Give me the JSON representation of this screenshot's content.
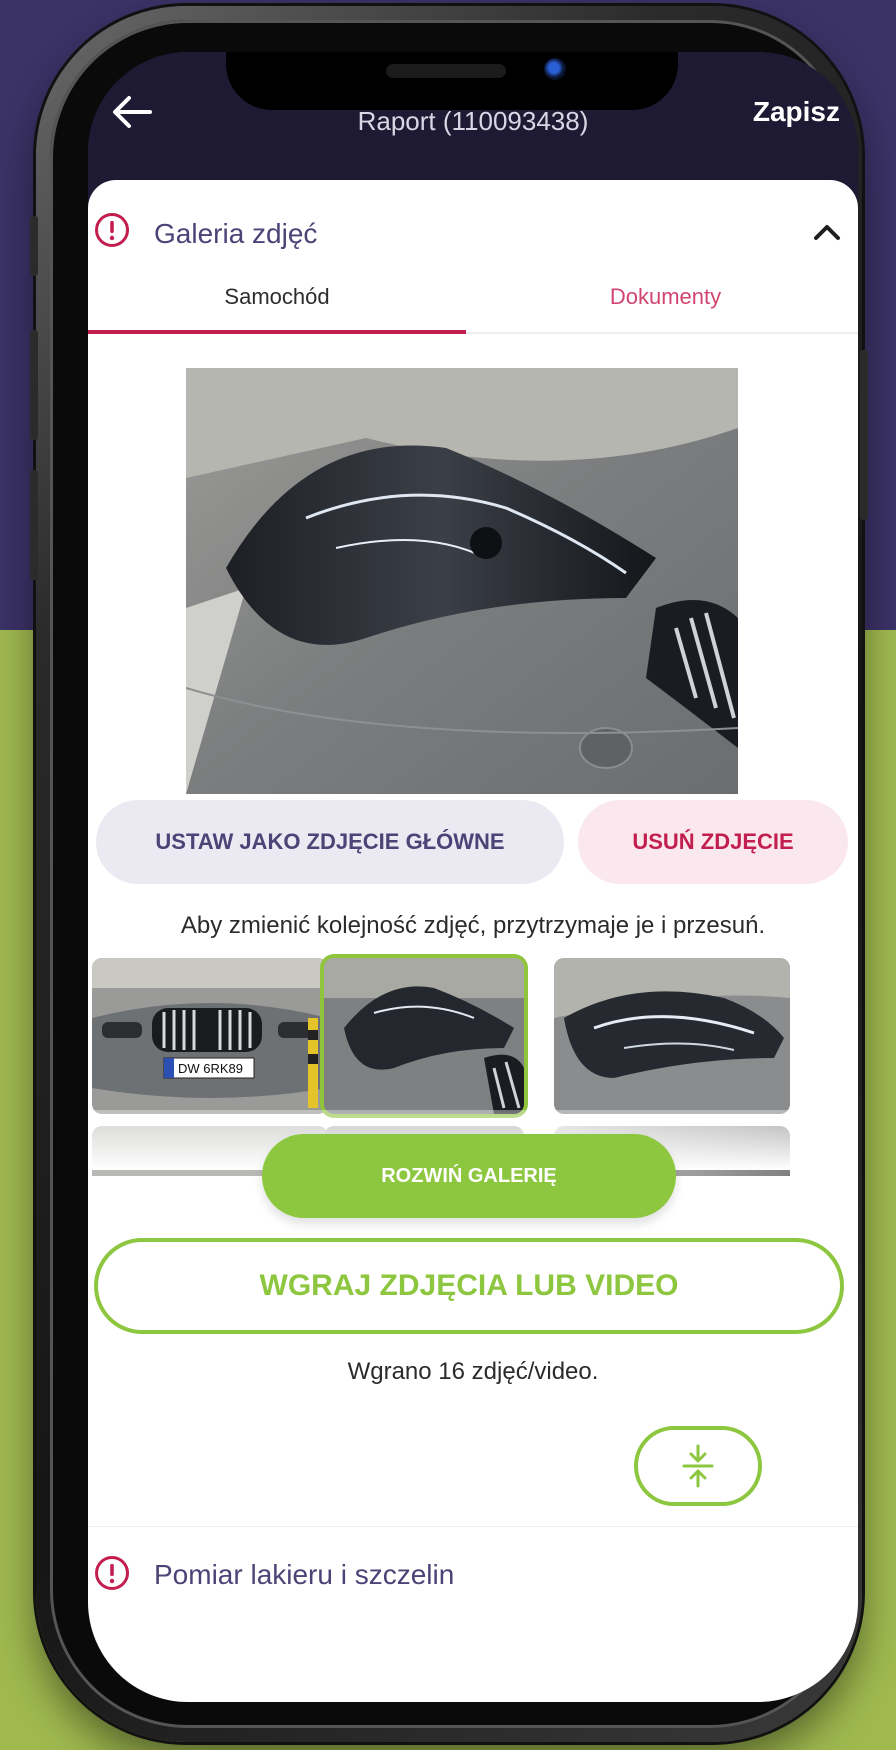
{
  "header": {
    "title": "Raport (110093438)",
    "save_label": "Zapisz"
  },
  "section_gallery": {
    "title": "Galeria zdjęć",
    "tabs": [
      {
        "label": "Samochód",
        "active": true
      },
      {
        "label": "Dokumenty",
        "active": false
      }
    ]
  },
  "actions": {
    "set_main_label": "USTAW JAKO ZDJĘCIE GŁÓWNE",
    "delete_label": "USUŃ ZDJĘCIE"
  },
  "hint": "Aby zmienić kolejność zdjęć, przytrzymaje je i przesuń.",
  "thumbnails": {
    "plate_text": "DW 6RK89"
  },
  "expand_label": "ROZWIŃ GALERIĘ",
  "upload_label": "WGRAJ ZDJĘCIA LUB VIDEO",
  "uploaded_text": "Wgrano 16 zdjęć/video.",
  "section_paint": {
    "title": "Pomiar lakieru i szczelin"
  },
  "colors": {
    "accent_green": "#8dc63f",
    "accent_red": "#c21f50",
    "primary_purple": "#4c4377",
    "header_bg": "#1e1a33"
  },
  "icons": {
    "back": "arrow-left-icon",
    "alert": "exclamation-circle-icon",
    "collapse": "chevron-up-icon",
    "fab": "compress-vertical-icon"
  }
}
